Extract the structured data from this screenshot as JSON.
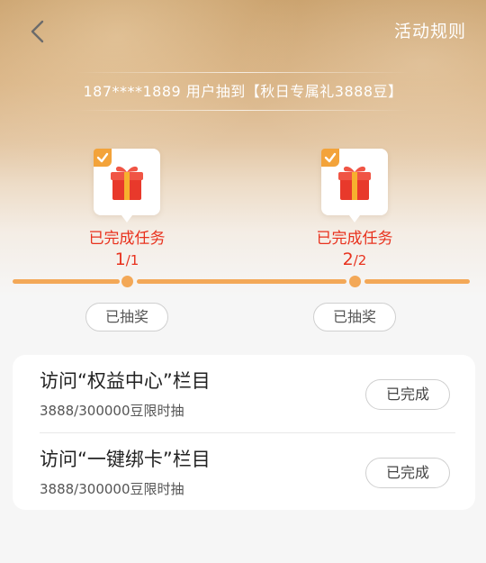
{
  "header": {
    "rules_label": "活动规则"
  },
  "notice": {
    "text": "187****1889 用户抽到【秋日专属礼3888豆】"
  },
  "milestones": [
    {
      "status": "已完成任务",
      "count_current": "1",
      "count_total": "/1",
      "button": "已抽奖"
    },
    {
      "status": "已完成任务",
      "count_current": "2",
      "count_total": "/2",
      "button": "已抽奖"
    }
  ],
  "tasks": [
    {
      "title": "访问“权益中心”栏目",
      "subtitle": "3888/300000豆限时抽",
      "button": "已完成"
    },
    {
      "title": "访问“一键绑卡”栏目",
      "subtitle": "3888/300000豆限时抽",
      "button": "已完成"
    }
  ],
  "icons": {
    "back": "chevron-left-icon",
    "gift": "gift-box-icon",
    "check": "checkmark-icon"
  },
  "colors": {
    "accent_orange": "#f3a857",
    "status_red": "#e8311d",
    "gift_red": "#e8392b"
  }
}
